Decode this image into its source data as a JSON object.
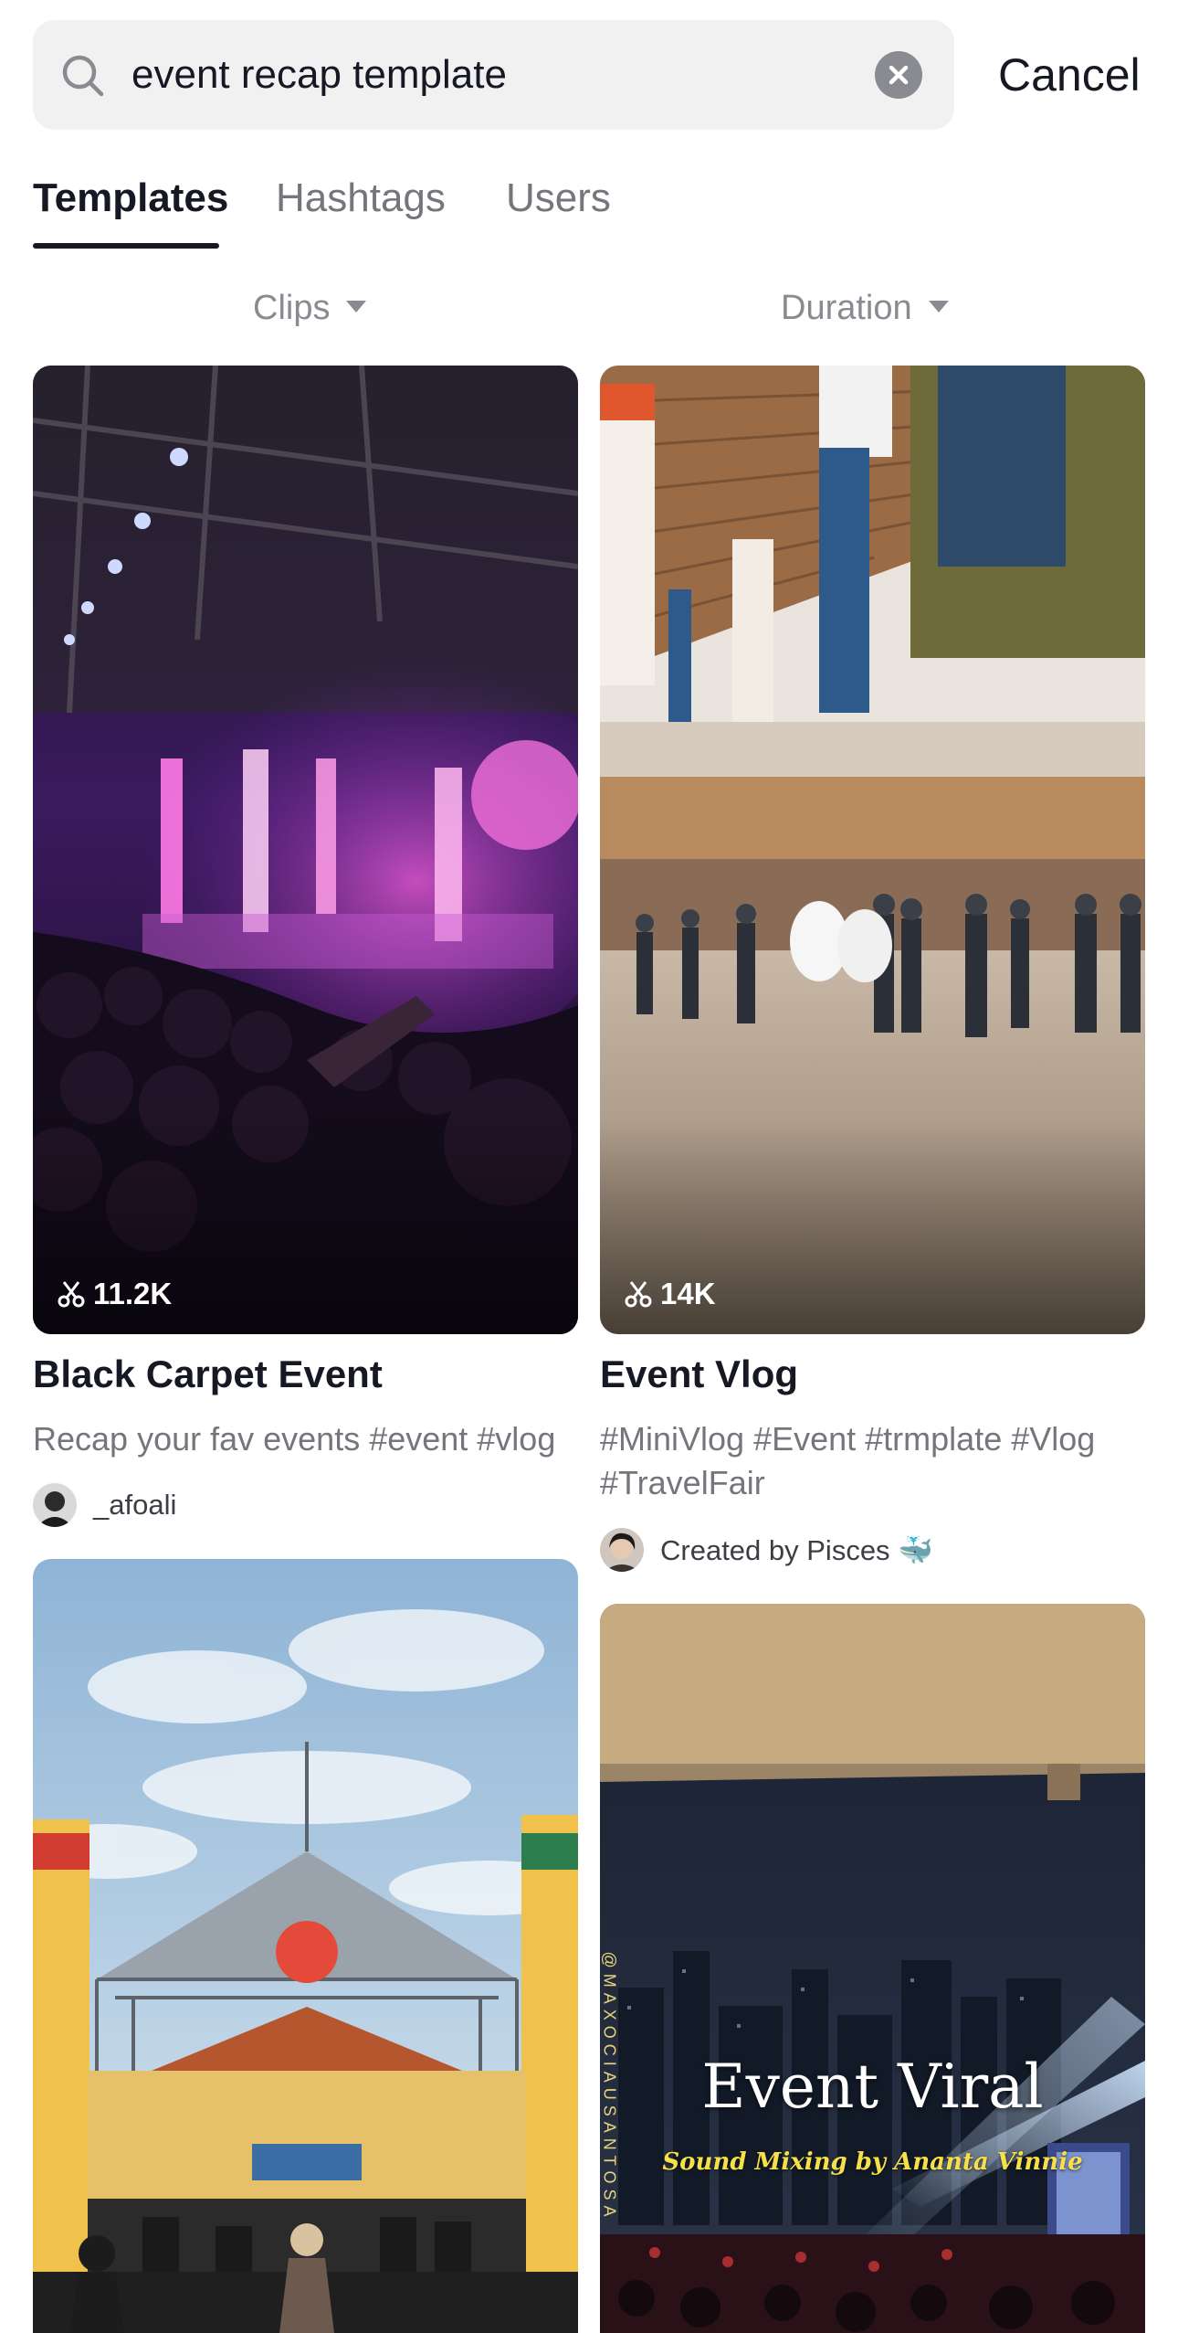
{
  "search": {
    "query": "event recap template",
    "cancel_label": "Cancel"
  },
  "tabs": [
    {
      "label": "Templates",
      "active": true
    },
    {
      "label": "Hashtags",
      "active": false
    },
    {
      "label": "Users",
      "active": false
    }
  ],
  "filters": [
    {
      "label": "Clips"
    },
    {
      "label": "Duration"
    }
  ],
  "cards": [
    {
      "title": "Black Carpet Event",
      "uses": "11.2K",
      "description": "Recap your fav events #event #vlog",
      "author": "_afoali"
    },
    {
      "title": "Event Vlog",
      "uses": "14K",
      "description": "#MiniVlog #Event #trmplate #Vlog #TravelFair",
      "author": "Created by Pisces 🐳"
    },
    {
      "overlay_title": "Event Viral",
      "overlay_subtitle": "Sound Mixing by Ananta Vinnie",
      "overlay_side_text": "@MAXOCIAUSANTOSA"
    }
  ],
  "colors": {
    "text_primary": "#161823",
    "text_secondary": "#75767c",
    "search_bg": "#f1f1f2",
    "subtitle_yellow": "#f5e04a"
  }
}
